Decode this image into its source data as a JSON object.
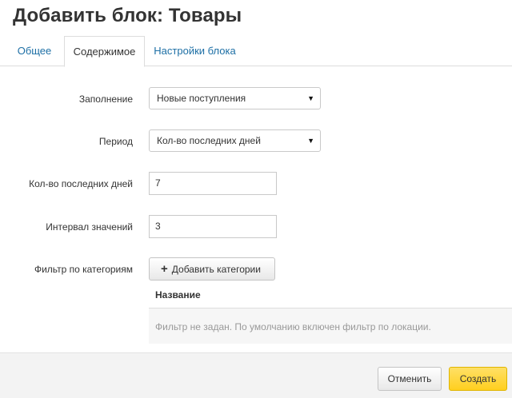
{
  "dialog": {
    "title": "Добавить блок: Товары"
  },
  "tabs": [
    {
      "label": "Общее",
      "active": false
    },
    {
      "label": "Содержимое",
      "active": true
    },
    {
      "label": "Настройки блока",
      "active": false
    }
  ],
  "form": {
    "fill": {
      "label": "Заполнение",
      "value": "Новые поступления"
    },
    "period": {
      "label": "Период",
      "value": "Кол-во последних дней"
    },
    "days": {
      "label": "Кол-во последних дней",
      "value": "7"
    },
    "interval": {
      "label": "Интервал значений",
      "value": "3"
    },
    "category_filter": {
      "label": "Фильтр по категориям",
      "add_button": "Добавить категории",
      "table_header": "Название",
      "empty_text": "Фильтр не задан. По умолчанию включен фильтр по локации."
    }
  },
  "footer": {
    "cancel_label": "Отменить",
    "create_label": "Создать"
  },
  "colors": {
    "link": "#1d6fa5",
    "primary_button": "#ffcf1f"
  },
  "icons": {
    "dropdown": "triangle-down",
    "add": "plus"
  }
}
